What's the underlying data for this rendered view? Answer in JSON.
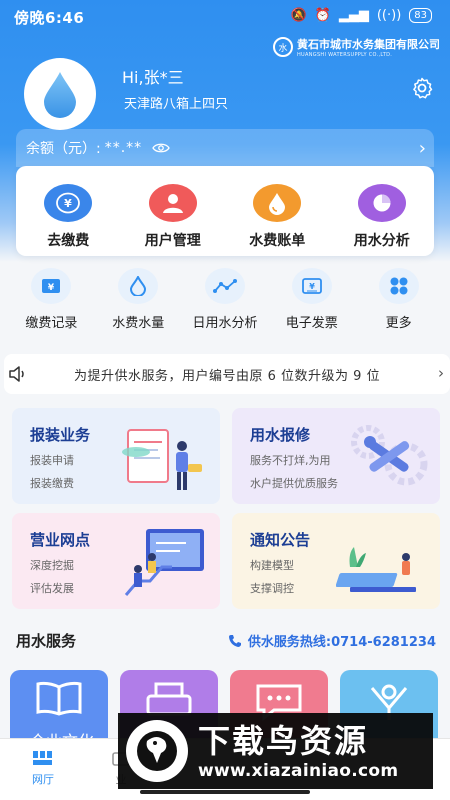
{
  "status_bar": {
    "time": "傍晚6:46",
    "battery": "83",
    "network": "HD"
  },
  "brand": {
    "name_cn": "黄石市城市水务集团有限公司",
    "name_en": "HUANGSHI WATERSUPPLY CO.,LTD."
  },
  "profile": {
    "greeting": "Hi,张*三",
    "address": "天津路八箱上四只"
  },
  "balance": {
    "label": "余额（元）:",
    "value": "**.**"
  },
  "main_actions": [
    {
      "label": "去缴费",
      "icon": "yen-coin-icon",
      "color": "#3a86ea",
      "glyph": "¥"
    },
    {
      "label": "用户管理",
      "icon": "user-icon",
      "color": "#f05a5a",
      "glyph": ""
    },
    {
      "label": "水费账单",
      "icon": "water-bill-icon",
      "color": "#f39a2e",
      "glyph": ""
    },
    {
      "label": "用水分析",
      "icon": "pie-chart-icon",
      "color": "#a05fe0",
      "glyph": ""
    }
  ],
  "secondary_actions": [
    {
      "label": "缴费记录",
      "icon": "payment-record-icon",
      "glyph": "¥"
    },
    {
      "label": "水费水量",
      "icon": "water-drop-icon",
      "glyph": ""
    },
    {
      "label": "日用水分析",
      "icon": "line-chart-icon",
      "glyph": ""
    },
    {
      "label": "电子发票",
      "icon": "invoice-icon",
      "glyph": "¥"
    },
    {
      "label": "更多",
      "icon": "grid-more-icon",
      "glyph": ""
    }
  ],
  "notice": {
    "text": "为提升供水服务，用户编号由原 6 位数升级为 9 位"
  },
  "features": [
    {
      "title": "报装业务",
      "lines": [
        "报装申请",
        "报装缴费"
      ],
      "bg": "#e9f0fb",
      "icon": "install-illustration"
    },
    {
      "title": "用水报修",
      "lines": [
        "服务不打烊,为用",
        "水户提供优质服务"
      ],
      "bg": "#eee9fa",
      "icon": "repair-illustration"
    },
    {
      "title": "营业网点",
      "lines": [
        "深度挖掘",
        "评估发展"
      ],
      "bg": "#fbe9f2",
      "icon": "outlet-illustration"
    },
    {
      "title": "通知公告",
      "lines": [
        "构建模型",
        "支撑调控"
      ],
      "bg": "#fbf4e4",
      "icon": "notice-illustration"
    }
  ],
  "service_section": {
    "title": "用水服务",
    "hotline": "供水服务热线:0714-6281234"
  },
  "service_cards": [
    {
      "label": "企业文化",
      "bg": "#5d8ff2"
    },
    {
      "label": "",
      "bg": "#b07de8"
    },
    {
      "label": "",
      "bg": "#f07b8f"
    },
    {
      "label": "",
      "bg": "#6cc0f0"
    }
  ],
  "tabs": [
    {
      "label": "网厅",
      "icon": "home-grid-icon",
      "active": true
    },
    {
      "label": "业",
      "icon": "business-icon",
      "active": false
    }
  ],
  "watermark": {
    "title": "下载鸟资源",
    "url": "www.xiazainiao.com"
  }
}
